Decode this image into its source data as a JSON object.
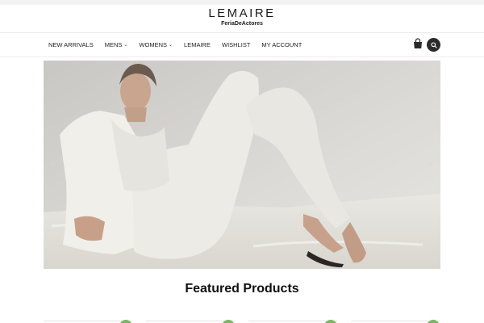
{
  "site": {
    "brand": "LEMAIRE",
    "tagline": "FeriaDeActores"
  },
  "nav": {
    "items": [
      {
        "label": "NEW ARRIVALS",
        "has_dropdown": false
      },
      {
        "label": "MENS",
        "has_dropdown": true
      },
      {
        "label": "WOMENS",
        "has_dropdown": true
      },
      {
        "label": "LEMAIRE",
        "has_dropdown": false
      },
      {
        "label": "WISHLIST",
        "has_dropdown": false
      },
      {
        "label": "MY ACCOUNT",
        "has_dropdown": false
      }
    ],
    "dropdown_glyph": "⌄",
    "icons": [
      "shopping-bag-icon",
      "search-icon"
    ]
  },
  "hero": {
    "image": "woman-in-white-suit-reclining-on-rug",
    "prev_glyph": "‹",
    "next_glyph": "›"
  },
  "featured": {
    "title": "Featured Products"
  },
  "colors": {
    "accent_green": "#7fb36a",
    "search_button": "#2b2b2b"
  }
}
